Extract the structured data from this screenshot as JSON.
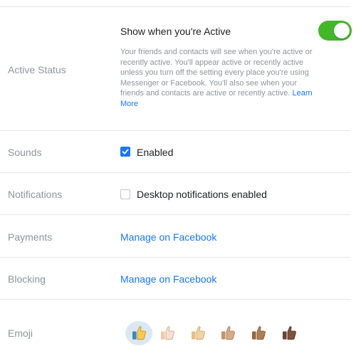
{
  "active_status": {
    "label": "Active Status",
    "title": "Show when you're Active",
    "toggle_on": true,
    "description": "Your friends and contacts will see when you're active or recently active. You'll appear active or recently active unless you turn off the setting every place you're using Messenger or Facebook. You'll also see when your friends and contacts are active or recently active.",
    "learn_more": "Learn More"
  },
  "sounds": {
    "label": "Sounds",
    "option": "Enabled",
    "checked": true
  },
  "notifications": {
    "label": "Notifications",
    "option": "Desktop notifications enabled",
    "checked": false
  },
  "payments": {
    "label": "Payments",
    "link": "Manage on Facebook"
  },
  "blocking": {
    "label": "Blocking",
    "link": "Manage on Facebook"
  },
  "emoji": {
    "label": "Emoji",
    "options": [
      {
        "name": "default",
        "selected": true
      },
      {
        "name": "light"
      },
      {
        "name": "medium-light"
      },
      {
        "name": "medium"
      },
      {
        "name": "medium-dark"
      },
      {
        "name": "dark"
      }
    ]
  },
  "colors": {
    "accent": "#1877f2",
    "toggle_on": "#42b72a",
    "divider": "#e4e6eb",
    "label_gray": "#8d949e"
  }
}
